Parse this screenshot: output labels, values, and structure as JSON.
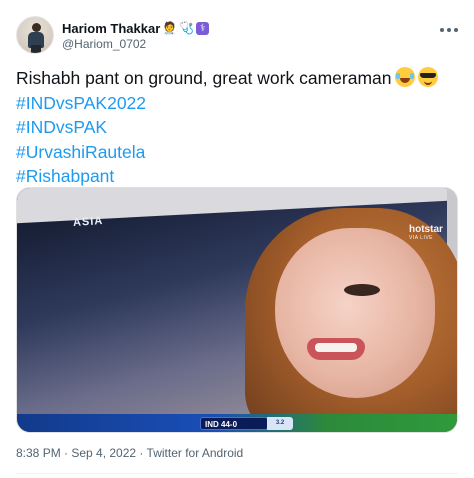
{
  "author": {
    "display_name": "Hariom Thakkar",
    "name_emojis": "👨‍⚕️🩺",
    "handle": "@Hariom_0702"
  },
  "tweet": {
    "lines": [
      "Rishabh pant on ground, great work cameraman",
      "#INDvsPAK2022",
      "#INDvsPAK",
      "#UrvashiRautela",
      "#Rishabpant"
    ],
    "trailing_emojis": [
      "face-with-tears-of-joy-icon",
      "smiling-face-with-sunglasses-icon"
    ]
  },
  "media": {
    "tv_logo": "ASIA",
    "streamer": "hotstar",
    "streamer_sub": "VIA LIVE",
    "score": "IND 44-0",
    "score_ext": "3.2"
  },
  "meta": {
    "timestamp": "8:38 PM · Sep 4, 2022 · Twitter for Android"
  },
  "colors": {
    "hashtag": "#1d9bf0",
    "secondary_text": "#536471",
    "primary_text": "#0f1419"
  }
}
